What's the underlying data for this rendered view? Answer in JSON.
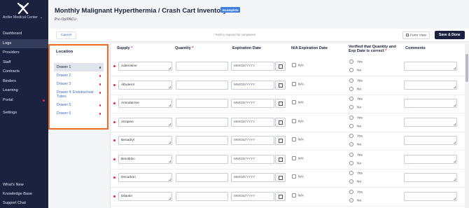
{
  "sidebar": {
    "org_name": "Antler Medical Center",
    "nav_items": [
      {
        "label": "Dashboard"
      },
      {
        "label": "Logs"
      },
      {
        "label": "Providers"
      },
      {
        "label": "Staff"
      },
      {
        "label": "Contracts"
      },
      {
        "label": "Binders"
      },
      {
        "label": "Learning"
      },
      {
        "label": "Portal"
      },
      {
        "label": "Settings"
      }
    ],
    "bottom_items": [
      {
        "label": "What's New"
      },
      {
        "label": "Knowledge Base"
      },
      {
        "label": "Support Chat"
      }
    ]
  },
  "header": {
    "title": "Monthly Malignant Hyperthermia / Crash Cart Inventory",
    "status_badge": "Incomplete",
    "subtitle": "Pre-Op/PACU"
  },
  "actionbar": {
    "cancel_label": "Cancel",
    "required_note": "* Field is required for completion",
    "form_view_label": "Form View",
    "save_label": "Save & Done"
  },
  "location": {
    "title": "Location",
    "items": [
      {
        "label": "Drawer 1"
      },
      {
        "label": "Drawer 2"
      },
      {
        "label": "Drawer 3"
      },
      {
        "label": "Drawer 4: Endotracheal Tubes"
      },
      {
        "label": "Drawer 5"
      },
      {
        "label": "Drawer 6"
      }
    ]
  },
  "table": {
    "columns": {
      "supply": "Supply",
      "quantity": "Quantity",
      "expiration": "Expiration Date",
      "na_expiration": "N/A Expiration Date",
      "verified_line1": "Verified that Quantity and",
      "verified_line2": "Exp Date is correct",
      "comments": "Comments"
    },
    "required_mark": "*",
    "date_placeholder": "MM/DD/YYYY",
    "na_label": "N/A",
    "yes_label": "Yes",
    "no_label": "No",
    "rows": [
      {
        "supply": "Adenosine"
      },
      {
        "supply": "Albuterol"
      },
      {
        "supply": "Amiodarone"
      },
      {
        "supply": "Atropine"
      },
      {
        "supply": "Benadryl"
      },
      {
        "supply": "Brevibloc"
      },
      {
        "supply": "Decadron"
      },
      {
        "supply": "Dilantin"
      }
    ]
  },
  "colors": {
    "sidebar_bg": "#1b2240",
    "highlight_outline": "#f06a28",
    "badge_bg": "#3f7de0",
    "required_dot": "#e0294b",
    "save_bg": "#1b2240"
  }
}
